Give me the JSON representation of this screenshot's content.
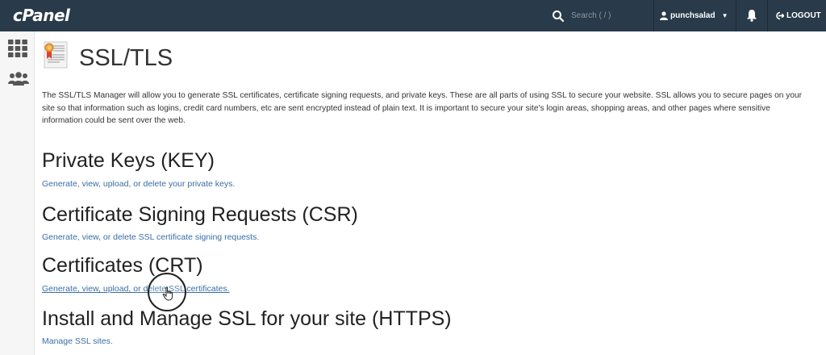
{
  "header": {
    "logo": "cPanel",
    "search_placeholder": "Search ( / )",
    "username": "punchsalad",
    "logout": "LOGOUT"
  },
  "sidebar": {
    "items": [
      {
        "icon": "grid-icon"
      },
      {
        "icon": "users-icon"
      }
    ]
  },
  "page": {
    "title": "SSL/TLS",
    "description": "The SSL/TLS Manager will allow you to generate SSL certificates, certificate signing requests, and private keys. These are all parts of using SSL to secure your website. SSL allows you to secure pages on your site so that information such as logins, credit card numbers, etc are sent encrypted instead of plain text. It is important to secure your site's login areas, shopping areas, and other pages where sensitive information could be sent over the web."
  },
  "sections": [
    {
      "title": "Private Keys (KEY)",
      "link": "Generate, view, upload, or delete your private keys."
    },
    {
      "title": "Certificate Signing Requests (CSR)",
      "link": "Generate, view, or delete SSL certificate signing requests."
    },
    {
      "title": "Certificates (CRT)",
      "link": "Generate, view, upload, or delete SSL certificates."
    },
    {
      "title": "Install and Manage SSL for your site (HTTPS)",
      "link": "Manage SSL sites."
    }
  ],
  "colors": {
    "topbar": "#293a4a",
    "link": "#3a6ea5"
  }
}
